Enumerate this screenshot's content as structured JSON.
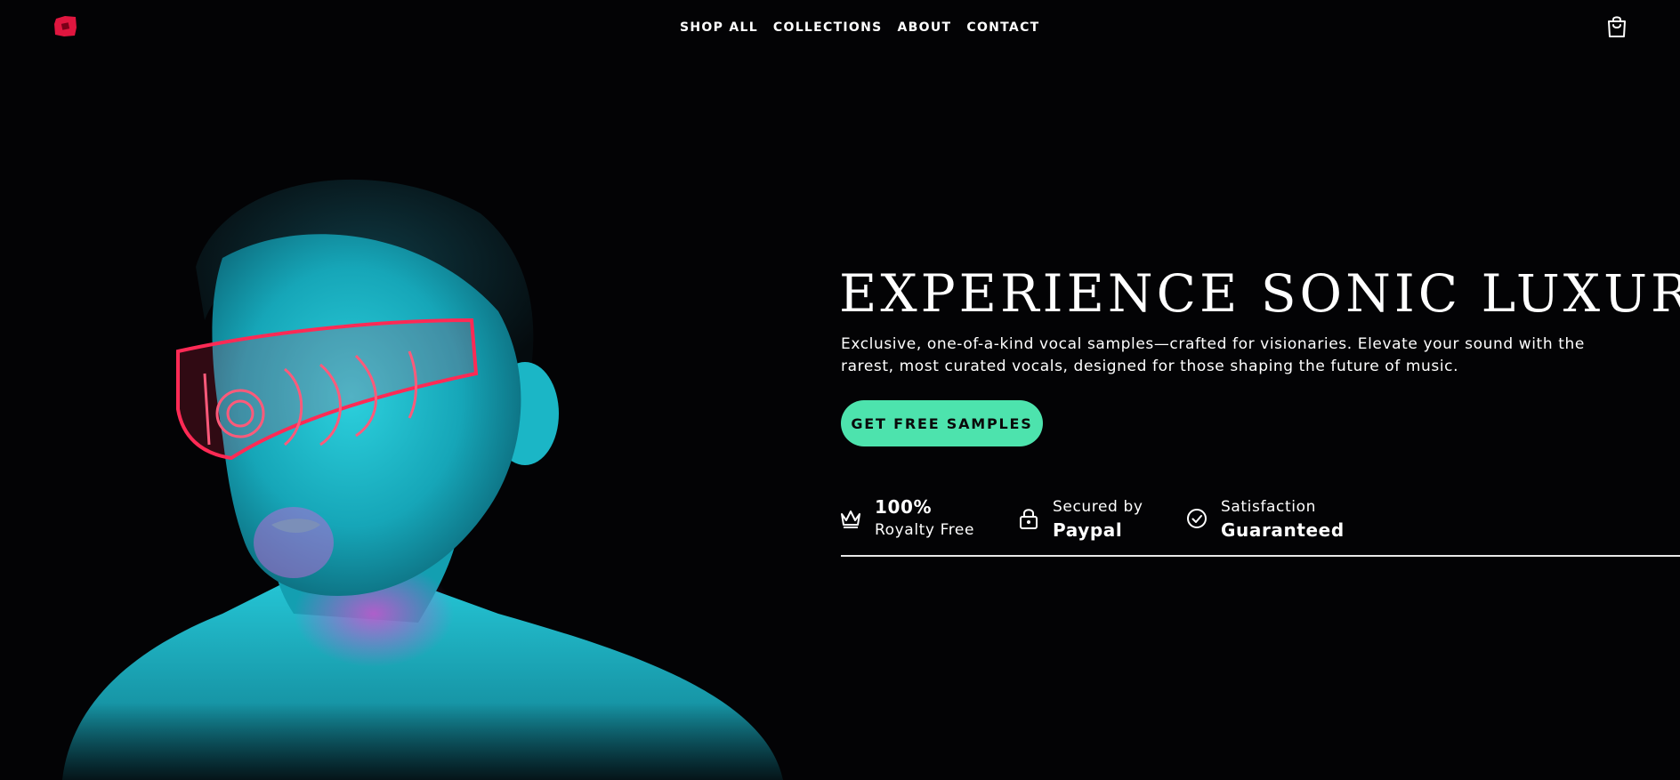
{
  "brand": {
    "logo_color": "#e0163f"
  },
  "nav": {
    "items": [
      {
        "label": "SHOP ALL"
      },
      {
        "label": "COLLECTIONS"
      },
      {
        "label": "ABOUT"
      },
      {
        "label": "CONTACT"
      }
    ]
  },
  "cart": {
    "icon": "shopping-bag-icon"
  },
  "hero": {
    "headline": "EXPERIENCE SONIC LUXURY",
    "subtitle": "Exclusive, one-of-a-kind vocal samples—crafted for visionaries. Elevate your sound with the rarest, most curated vocals, designed for those shaping the future of music.",
    "cta_label": "GET FREE SAMPLES",
    "cta_color": "#4de3ad",
    "image": {
      "subject": "woman-with-neon-visor",
      "visor_color": "#ff2a55",
      "skin_light_color": "#1fbfd0"
    }
  },
  "badges": [
    {
      "icon": "crown-icon",
      "line1": "100%",
      "line2": "Royalty Free"
    },
    {
      "icon": "lock-icon",
      "line1": "Secured by",
      "line2": "Paypal"
    },
    {
      "icon": "check-circle-icon",
      "line1": "Satisfaction",
      "line2": "Guaranteed"
    }
  ]
}
